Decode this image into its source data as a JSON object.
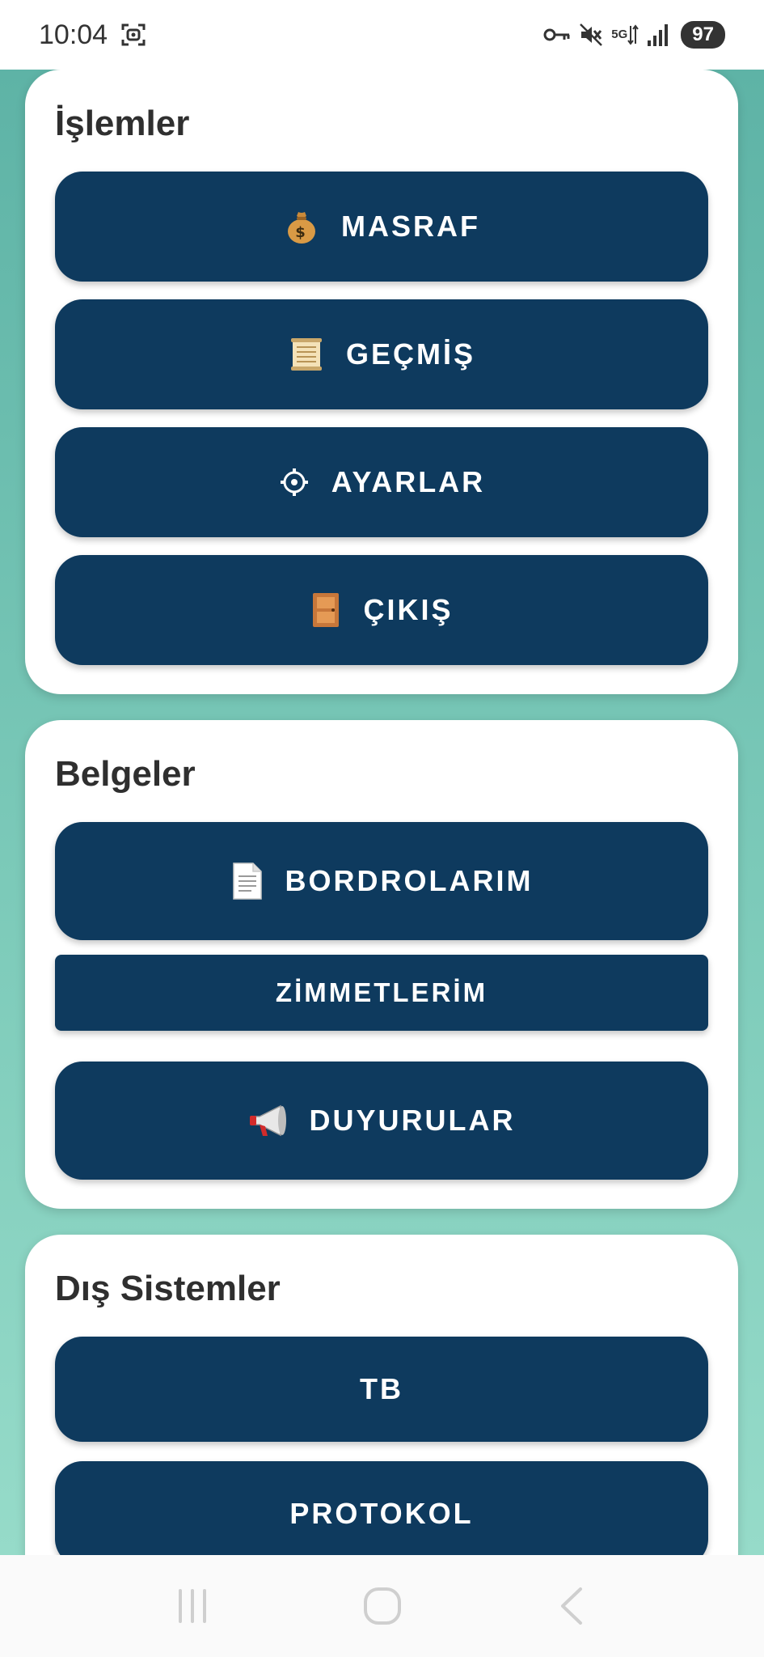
{
  "status_bar": {
    "time": "10:04",
    "network_label": "5G",
    "battery": "97"
  },
  "cards": [
    {
      "title": "İşlemler",
      "buttons": [
        {
          "label": "MASRAF",
          "icon": "money-bag-icon"
        },
        {
          "label": "GEÇMİŞ",
          "icon": "scroll-icon"
        },
        {
          "label": "AYARLAR",
          "icon": "gear-icon"
        },
        {
          "label": "ÇIKIŞ",
          "icon": "door-icon"
        }
      ]
    },
    {
      "title": "Belgeler",
      "buttons": [
        {
          "label": "BORDROLARIM",
          "icon": "document-icon"
        },
        {
          "label": "ZİMMETLERİM",
          "icon": ""
        },
        {
          "label": "DUYURULAR",
          "icon": "megaphone-icon"
        }
      ]
    },
    {
      "title": "Dış Sistemler",
      "buttons": [
        {
          "label": "TB",
          "icon": ""
        },
        {
          "label": "PROTOKOL",
          "icon": ""
        }
      ]
    }
  ],
  "colors": {
    "button_bg": "#0e3a5e",
    "background_gradient_top": "#5eb3a6",
    "background_gradient_bottom": "#96dbc9",
    "card_bg": "#ffffff"
  }
}
